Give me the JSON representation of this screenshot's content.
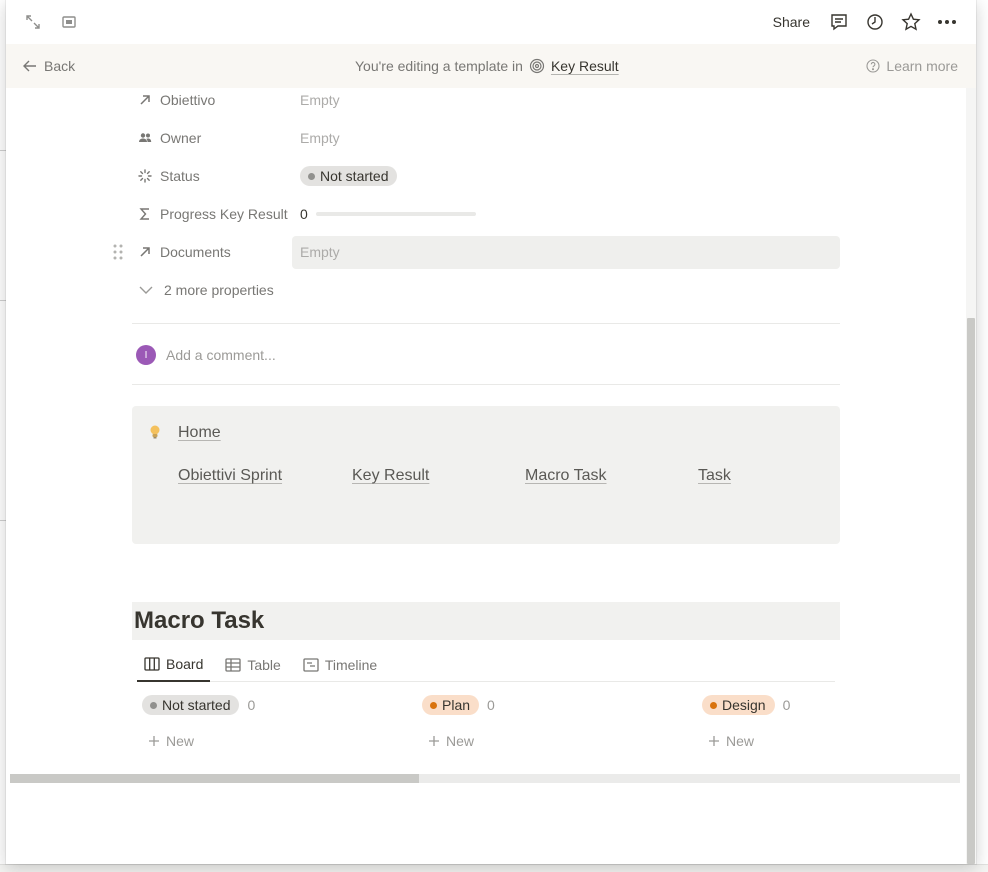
{
  "topbar": {
    "share_label": "Share",
    "left_icons": [
      "expand-icon",
      "side-peek-icon"
    ],
    "right_icons": [
      "comment-icon",
      "history-icon",
      "star-icon",
      "more-icon"
    ]
  },
  "banner": {
    "back_label": "Back",
    "editing_text": "You're editing a template in",
    "database_name": "Key Result",
    "learn_more_label": "Learn more"
  },
  "properties": [
    {
      "name": "Obiettivo",
      "icon": "relation-arrow-icon",
      "value": "Empty"
    },
    {
      "name": "Owner",
      "icon": "people-icon",
      "value": "Empty"
    },
    {
      "name": "Status",
      "icon": "status-icon",
      "value": "Not started"
    },
    {
      "name": "Progress Key Result",
      "icon": "sigma-icon",
      "value": "0",
      "progress": 0
    },
    {
      "name": "Documents",
      "icon": "relation-arrow-icon",
      "value": "Empty"
    }
  ],
  "more_properties_label": "2 more properties",
  "comment": {
    "avatar_initial": "I",
    "placeholder": "Add a comment..."
  },
  "callout": {
    "icon": "lightbulb-icon",
    "title": "Home",
    "links": [
      "Obiettivi Sprint",
      "Key Result",
      "Macro Task",
      "Task"
    ]
  },
  "database": {
    "title": "Macro Task",
    "tabs": [
      {
        "label": "Board",
        "icon": "board-icon",
        "active": true
      },
      {
        "label": "Table",
        "icon": "table-icon",
        "active": false
      },
      {
        "label": "Timeline",
        "icon": "timeline-icon",
        "active": false
      }
    ],
    "columns": [
      {
        "label": "Not started",
        "count": "0",
        "color": "#91918e"
      },
      {
        "label": "Plan",
        "count": "0",
        "color": "#d9730d"
      },
      {
        "label": "Design",
        "count": "0",
        "color": "#d9730d"
      }
    ],
    "new_label": "New"
  },
  "colors": {
    "text": "#37352f",
    "muted": "#787774",
    "banner_bg": "#f9f7f3",
    "callout_bg": "#f1f1ef",
    "avatar": "#9b59b6"
  }
}
